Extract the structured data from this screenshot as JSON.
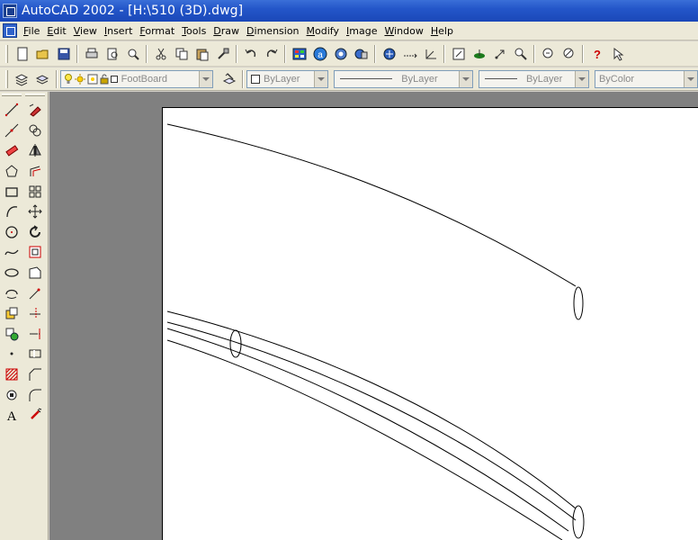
{
  "window": {
    "title": "AutoCAD 2002 - [H:\\510 (3D).dwg]"
  },
  "menu": [
    {
      "name": "menu-file",
      "mn": "F",
      "rest": "ile"
    },
    {
      "name": "menu-edit",
      "mn": "E",
      "rest": "dit"
    },
    {
      "name": "menu-view",
      "mn": "V",
      "rest": "iew"
    },
    {
      "name": "menu-insert",
      "mn": "I",
      "rest": "nsert"
    },
    {
      "name": "menu-format",
      "mn": "F",
      "rest": "ormat"
    },
    {
      "name": "menu-tools",
      "mn": "T",
      "rest": "ools"
    },
    {
      "name": "menu-draw",
      "mn": "D",
      "rest": "raw"
    },
    {
      "name": "menu-dimension",
      "mn": "D",
      "rest": "imension"
    },
    {
      "name": "menu-modify",
      "mn": "M",
      "rest": "odify"
    },
    {
      "name": "menu-image",
      "mn": "I",
      "rest": "mage"
    },
    {
      "name": "menu-window",
      "mn": "W",
      "rest": "indow"
    },
    {
      "name": "menu-help",
      "mn": "H",
      "rest": "elp"
    }
  ],
  "properties": {
    "layer": "FootBoard",
    "color": "ByLayer",
    "linetype": "ByLayer",
    "lineweight": "ByLayer",
    "plotstyle": "ByColor"
  },
  "icons": {
    "standard_toolbar": [
      "new-icon",
      "open-icon",
      "save-icon",
      "print-icon",
      "plot-preview-icon",
      "publish-icon",
      "cut-icon",
      "copy-icon",
      "paste-icon",
      "match-properties-icon",
      "undo-icon",
      "redo-icon",
      "autocad-today-icon",
      "web-icon",
      "design-center-icon",
      "object-properties-icon",
      "ucs-icon",
      "measure-icon",
      "aerial-view-icon",
      "pan-icon",
      "zoom-realtime-icon",
      "zoom-window-icon",
      "zoom-previous-icon",
      "properties-icon",
      "dbconnect-icon",
      "help-icon",
      "arrow-icon"
    ],
    "draw_palette": [
      "line-icon",
      "construction-line-icon",
      "polyline-icon",
      "polygon-icon",
      "rectangle-icon",
      "arc-icon",
      "circle-icon",
      "spline-icon",
      "ellipse-icon",
      "ellipse-arc-icon",
      "insert-block-icon",
      "make-block-icon",
      "point-icon",
      "hatch-icon",
      "region-icon",
      "text-icon"
    ],
    "modify_palette": [
      "erase-icon",
      "copy-object-icon",
      "mirror-icon",
      "offset-icon",
      "array-icon",
      "move-icon",
      "rotate-icon",
      "scale-icon",
      "stretch-icon",
      "lengthen-icon",
      "trim-icon",
      "extend-icon",
      "break-icon",
      "chamfer-icon",
      "fillet-icon",
      "explode-icon"
    ]
  },
  "colors": {
    "titlebar": "#2456c9",
    "chrome": "#ece9d8",
    "workspace": "#808080",
    "paper": "#ffffff"
  }
}
